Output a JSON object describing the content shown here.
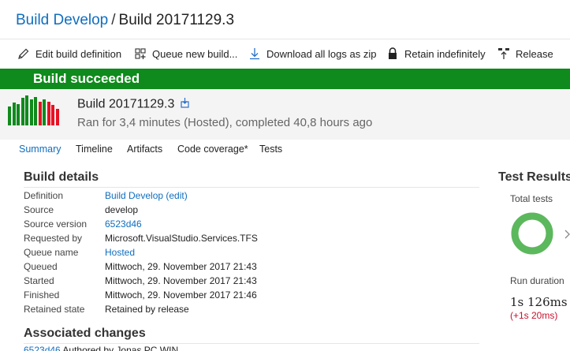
{
  "breadcrumb": {
    "definition_link": "Build Develop",
    "separator": "/",
    "current": "Build 20171129.3"
  },
  "toolbar": {
    "edit": "Edit build definition",
    "queue": "Queue new build...",
    "download": "Download all logs as zip",
    "retain": "Retain indefinitely",
    "release": "Release"
  },
  "banner": {
    "text": "Build succeeded",
    "color": "#0f8a1c"
  },
  "build": {
    "title": "Build 20171129.3",
    "subtitle": "Ran for 3,4 minutes (Hosted), completed 40,8 hours ago",
    "history": [
      {
        "level": 0.62,
        "status": "succeeded"
      },
      {
        "level": 0.75,
        "status": "succeeded"
      },
      {
        "level": 0.7,
        "status": "succeeded"
      },
      {
        "level": 0.92,
        "status": "succeeded"
      },
      {
        "level": 1.0,
        "status": "succeeded"
      },
      {
        "level": 0.86,
        "status": "succeeded"
      },
      {
        "level": 0.95,
        "status": "succeeded"
      },
      {
        "level": 0.8,
        "status": "failed"
      },
      {
        "level": 0.88,
        "status": "succeeded"
      },
      {
        "level": 0.78,
        "status": "failed"
      },
      {
        "level": 0.68,
        "status": "failed"
      },
      {
        "level": 0.55,
        "status": "failed"
      }
    ]
  },
  "tabs": {
    "summary": "Summary",
    "timeline": "Timeline",
    "artifacts": "Artifacts",
    "coverage": "Code coverage*",
    "tests": "Tests"
  },
  "build_details": {
    "title": "Build details",
    "rows": [
      {
        "label": "Definition",
        "value": "Build Develop (edit)"
      },
      {
        "label": "Source",
        "value": "develop"
      },
      {
        "label": "Source version",
        "value": "6523d46"
      },
      {
        "label": "Requested by",
        "value": "Microsoft.VisualStudio.Services.TFS"
      },
      {
        "label": "Queue name",
        "value": "Hosted"
      },
      {
        "label": "Queued",
        "value": "Mittwoch, 29. November 2017 21:43"
      },
      {
        "label": "Started",
        "value": "Mittwoch, 29. November 2017 21:43"
      },
      {
        "label": "Finished",
        "value": "Mittwoch, 29. November 2017 21:46"
      },
      {
        "label": "Retained state",
        "value": "Retained by release"
      }
    ]
  },
  "associated_changes": {
    "title": "Associated changes",
    "commit": "6523d46",
    "author": "Authored by Jonas PC WIN"
  },
  "test_results": {
    "title": "Test Results",
    "total_label": "Total tests",
    "pass_fraction": 1.0,
    "ring_color": "#5cb85c",
    "duration_label": "Run duration",
    "duration": "1s 126ms",
    "duration_delta": "(+1s 20ms)"
  }
}
